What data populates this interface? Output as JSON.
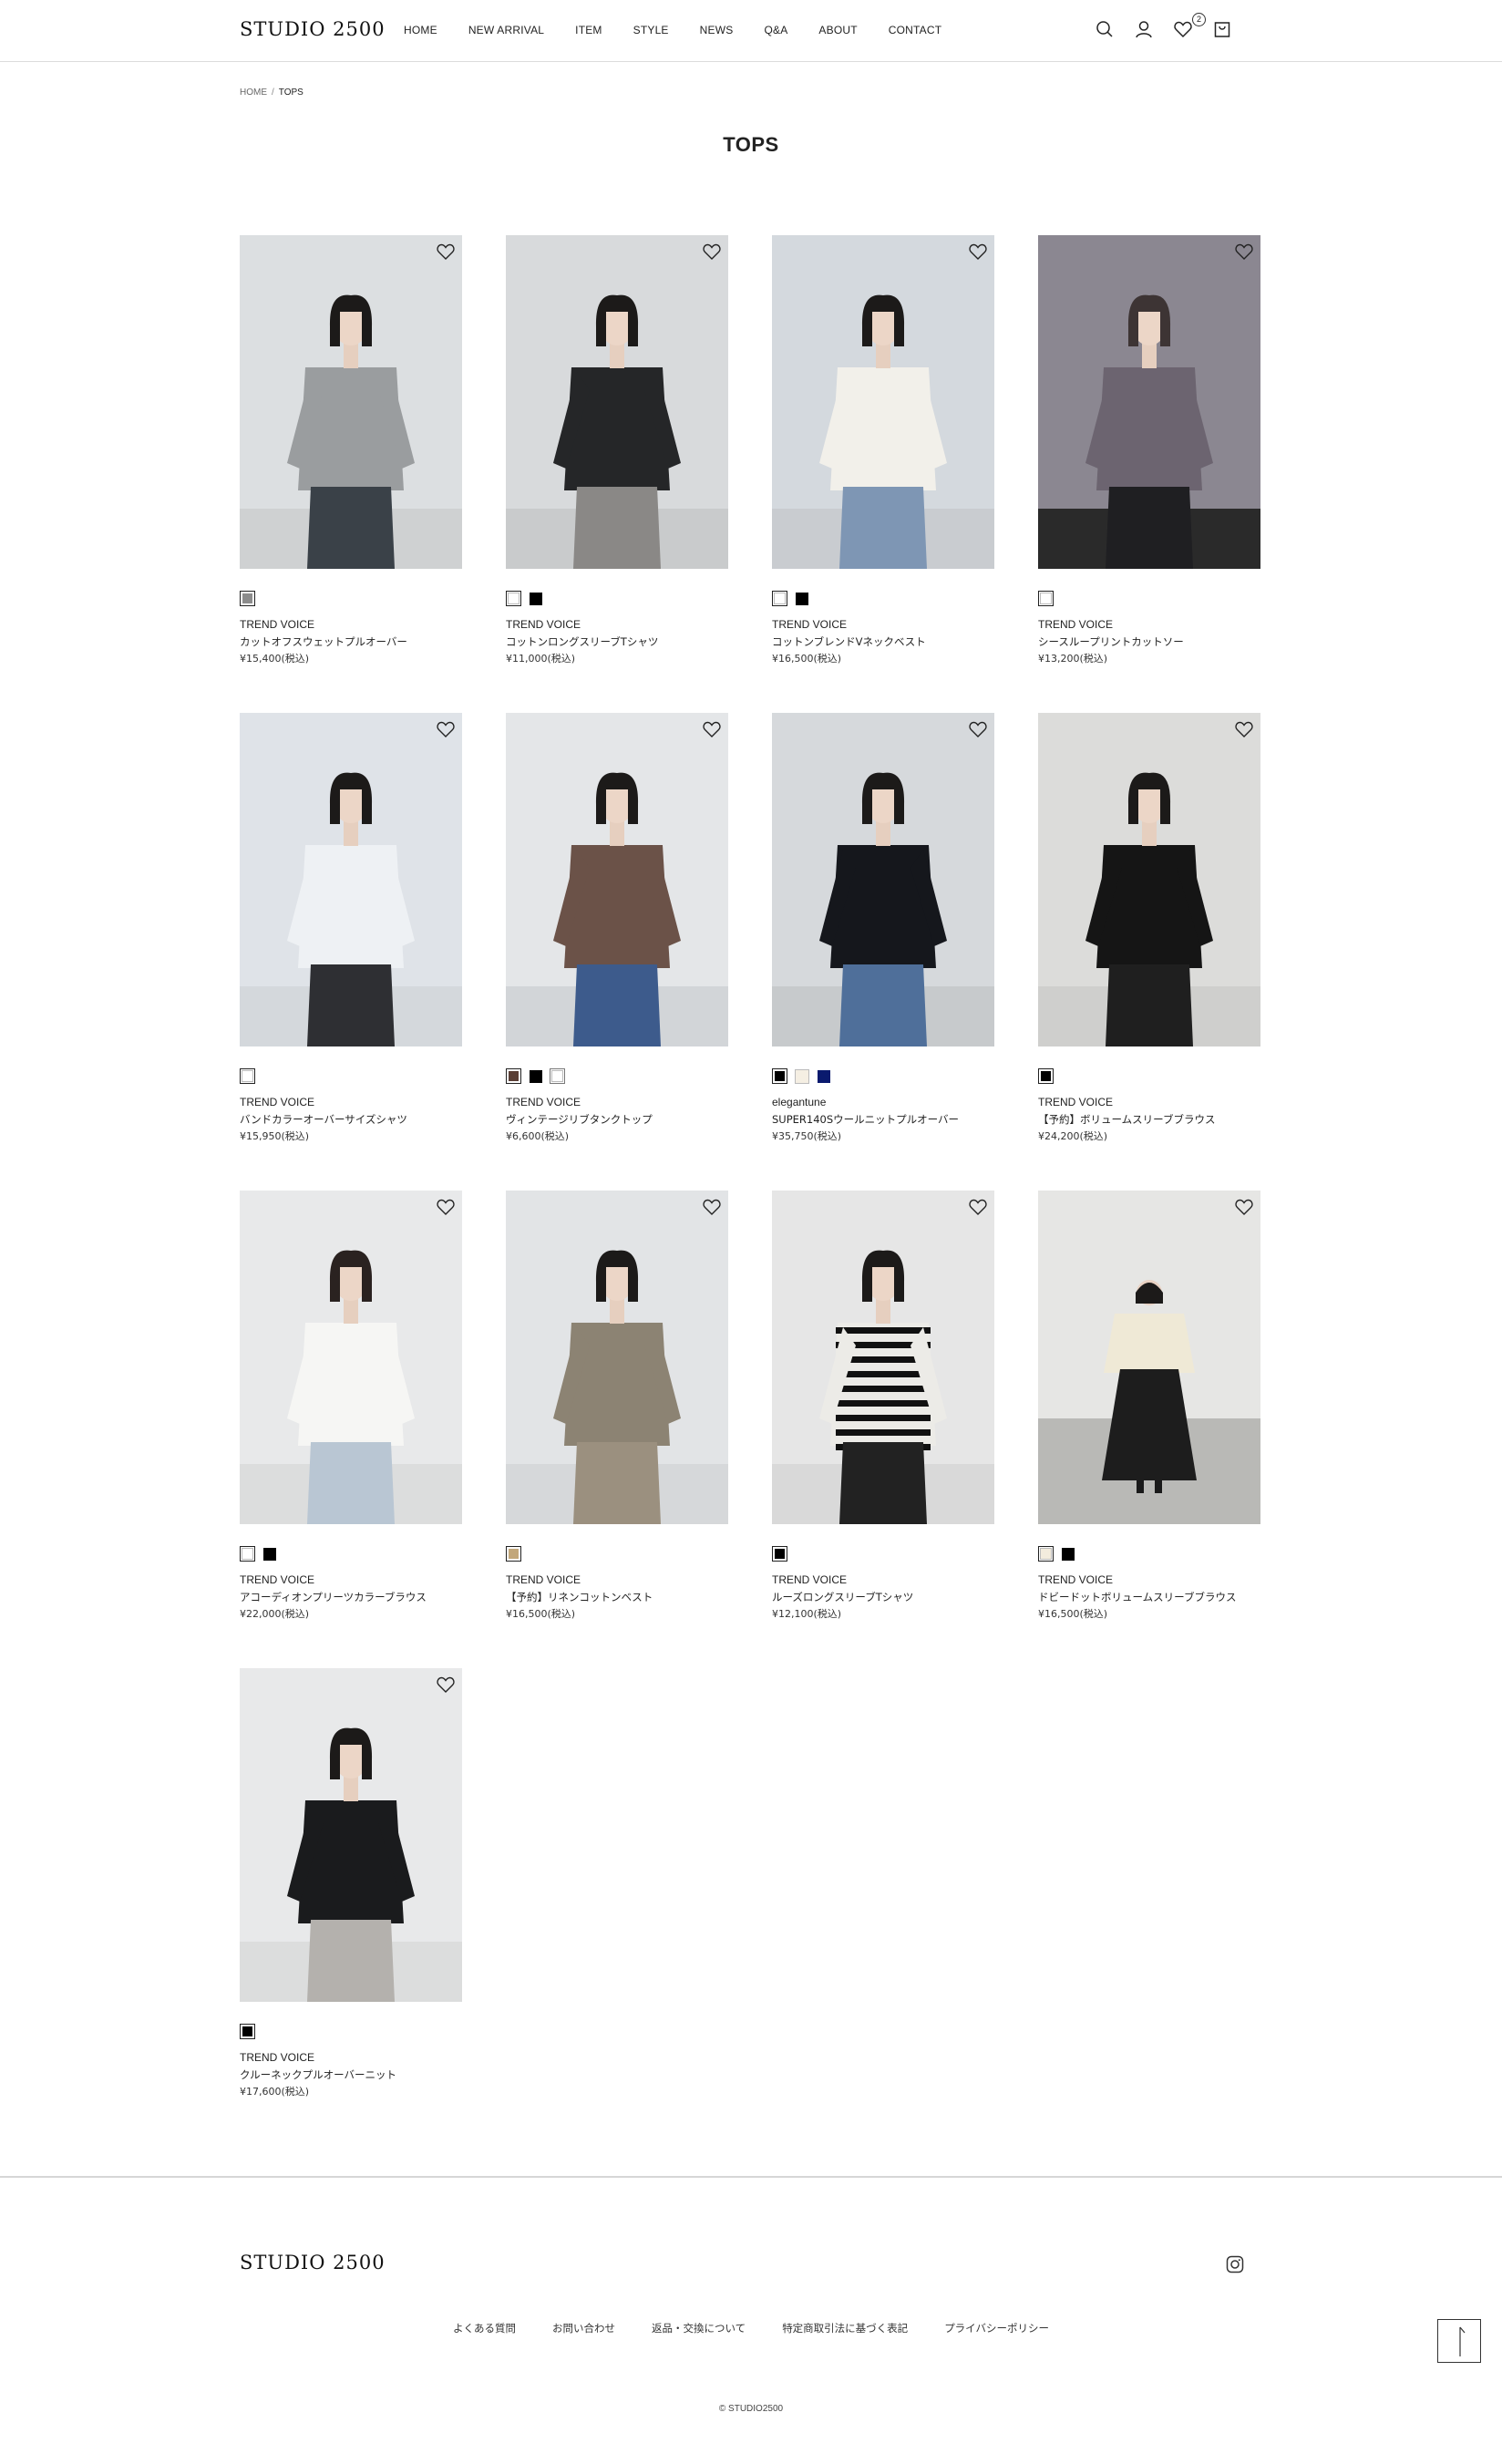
{
  "header": {
    "logo": "STUDIO 2500",
    "nav": [
      "HOME",
      "NEW ARRIVAL",
      "ITEM",
      "STYLE",
      "NEWS",
      "Q&A",
      "ABOUT",
      "CONTACT"
    ],
    "icons": [
      "search-icon",
      "account-icon",
      "wishlist-icon",
      "cart-icon"
    ],
    "wishlist_count": "2"
  },
  "breadcrumb": {
    "home": "HOME",
    "separator": "/",
    "current": "TOPS"
  },
  "page_title": "TOPS",
  "products": [
    {
      "brand": "TREND VOICE",
      "name": "カットオフスウェットプルオーバー",
      "price": "¥15,400(税込)",
      "swatches": [
        "#8c8c8c"
      ]
    },
    {
      "brand": "TREND VOICE",
      "name": "コットンロングスリーブTシャツ",
      "price": "¥11,000(税込)",
      "swatches": [
        "#ffffff",
        "#000000"
      ]
    },
    {
      "brand": "TREND VOICE",
      "name": "コットンブレンドVネックベスト",
      "price": "¥16,500(税込)",
      "swatches": [
        "#ffffff",
        "#000000"
      ]
    },
    {
      "brand": "TREND VOICE",
      "name": "シースループリントカットソー",
      "price": "¥13,200(税込)",
      "swatches": [
        "#ffffff"
      ]
    },
    {
      "brand": "TREND VOICE",
      "name": "バンドカラーオーバーサイズシャツ",
      "price": "¥15,950(税込)",
      "swatches": [
        "#ffffff"
      ]
    },
    {
      "brand": "TREND VOICE",
      "name": "ヴィンテージリブタンクトップ",
      "price": "¥6,600(税込)",
      "swatches": [
        "#5a3e35",
        "#000000",
        "#ffffff"
      ]
    },
    {
      "brand": "elegantune",
      "name": "SUPER140Sウールニットプルオーバー",
      "price": "¥35,750(税込)",
      "swatches": [
        "#000000",
        "#f5efe3",
        "#0a1a6e"
      ]
    },
    {
      "brand": "TREND VOICE",
      "name": "【予約】ボリュームスリーブブラウス",
      "price": "¥24,200(税込)",
      "swatches": [
        "#000000"
      ]
    },
    {
      "brand": "TREND VOICE",
      "name": "アコーディオンプリーツカラーブラウス",
      "price": "¥22,000(税込)",
      "swatches": [
        "#ffffff",
        "#000000"
      ]
    },
    {
      "brand": "TREND VOICE",
      "name": "【予約】リネンコットンベスト",
      "price": "¥16,500(税込)",
      "swatches": [
        "#c2a77a"
      ]
    },
    {
      "brand": "TREND VOICE",
      "name": "ルーズロングスリーブTシャツ",
      "price": "¥12,100(税込)",
      "swatches": [
        "#000000"
      ]
    },
    {
      "brand": "TREND VOICE",
      "name": "ドビードットボリュームスリーブブラウス",
      "price": "¥16,500(税込)",
      "swatches": [
        "#f3ecdd",
        "#000000"
      ]
    },
    {
      "brand": "TREND VOICE",
      "name": "クルーネックプルオーバーニット",
      "price": "¥17,600(税込)",
      "swatches": [
        "#000000"
      ]
    }
  ],
  "footer": {
    "logo": "STUDIO 2500",
    "links": [
      "よくある質問",
      "お問い合わせ",
      "返品・交換について",
      "特定商取引法に基づく表記",
      "プライバシーポリシー"
    ],
    "copyright": "© STUDIO2500"
  },
  "colors": {
    "text": "#222222",
    "border": "#dcdcdc",
    "photo_bg": "#d9dcdf"
  }
}
